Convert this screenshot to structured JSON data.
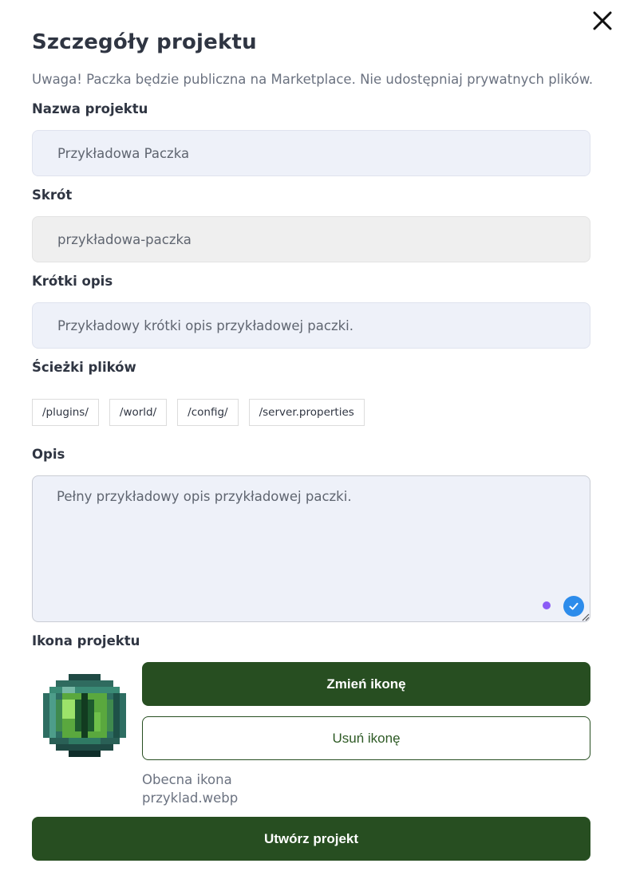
{
  "dialog": {
    "title": "Szczegóły projektu",
    "warning": "Uwaga! Paczka będzie publiczna na Marketplace. Nie udostępniaj prywatnych plików."
  },
  "fields": {
    "name": {
      "label": "Nazwa projektu",
      "placeholder": "Przykładowa Paczka"
    },
    "slug": {
      "label": "Skrót",
      "placeholder": "przykładowa-paczka"
    },
    "short_description": {
      "label": "Krótki opis",
      "placeholder": "Przykładowy krótki opis przykładowej paczki."
    },
    "file_paths": {
      "label": "Ścieżki plików",
      "chips": [
        "/plugins/",
        "/world/",
        "/config/",
        "/server.properties"
      ]
    },
    "description": {
      "label": "Opis",
      "placeholder": "Pełny przykładowy opis przykładowej paczki."
    }
  },
  "project_icon": {
    "label": "Ikona projektu",
    "icon_name": "ender-eye-icon",
    "change_label": "Zmień ikonę",
    "remove_label": "Usuń ikonę",
    "current_label": "Obecna ikona",
    "current_file": "przyklad.webp"
  },
  "submit_label": "Utwórz projekt",
  "colors": {
    "primary": "#274e21",
    "field_bg": "#eef1f9",
    "readonly_bg": "#efefef",
    "check_badge": "#2d8ceb",
    "purple_dot": "#8b5cf6"
  }
}
